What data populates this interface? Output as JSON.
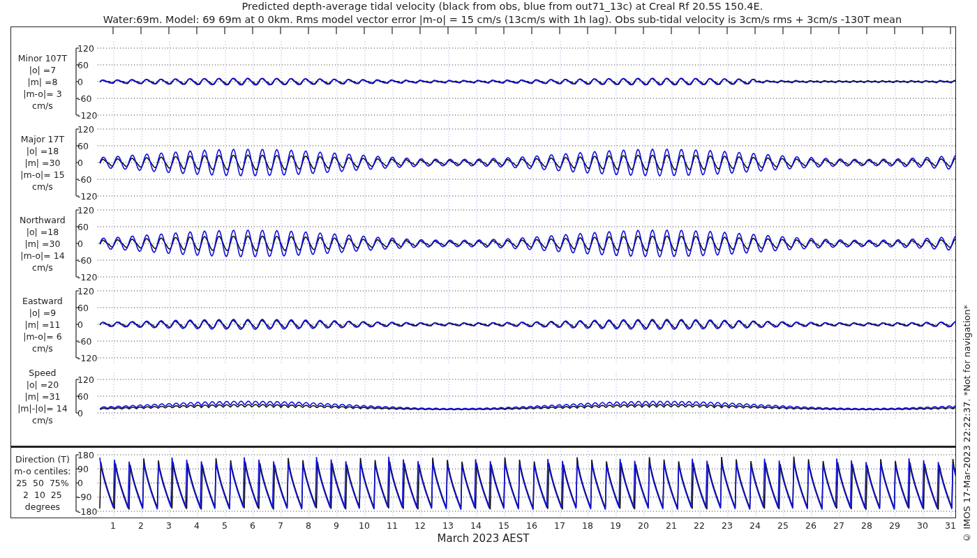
{
  "title_lines": [
    "Predicted depth-average tidal velocity (black from obs, blue from out71_13c) at Creal Rf 20.5S 150.4E.",
    "Water:69m. Model: 69 69m at 0 0km. Rms model vector error |m-o| = 15 cm/s (13cm/s with 1h lag). Obs sub-tidal velocity is 3cm/s rms + 3cm/s -130T mean"
  ],
  "panels": [
    {
      "kind": "velocity",
      "label_lines": [
        "Minor 107T",
        "|o| =7",
        "|m| =8",
        "|m-o|= 3",
        "cm/s"
      ],
      "yticks": [
        "120",
        "60",
        "0",
        "-60",
        "-120"
      ]
    },
    {
      "kind": "velocity",
      "label_lines": [
        "Major 17T",
        "|o| =18",
        "|m| =30",
        "|m-o|= 15",
        "cm/s"
      ],
      "yticks": [
        "120",
        "60",
        "0",
        "-60",
        "-120"
      ]
    },
    {
      "kind": "velocity",
      "label_lines": [
        "Northward",
        "|o| =18",
        "|m| =30",
        "|m-o|= 14",
        "cm/s"
      ],
      "yticks": [
        "120",
        "60",
        "0",
        "-60",
        "-120"
      ]
    },
    {
      "kind": "velocity",
      "label_lines": [
        "Eastward",
        "|o| =9",
        "|m| =11",
        "|m-o|= 6",
        "cm/s"
      ],
      "yticks": [
        "120",
        "60",
        "0",
        "-60",
        "-120"
      ]
    },
    {
      "kind": "speed",
      "label_lines": [
        "Speed",
        "|o| =20",
        "|m| =31",
        "|m|-|o|= 14",
        "cm/s"
      ],
      "yticks": [
        "120",
        "60",
        "0"
      ]
    }
  ],
  "direction_panel": {
    "kind": "direction",
    "label_lines": [
      "Direction (T)",
      "m-o centiles:",
      "25  50  75%",
      "2  10  25",
      "degrees"
    ],
    "yticks": [
      "180",
      "90",
      "0",
      "-90",
      "-180"
    ]
  },
  "x_ticks": [
    "1",
    "2",
    "3",
    "4",
    "5",
    "6",
    "7",
    "8",
    "9",
    "10",
    "11",
    "12",
    "13",
    "14",
    "15",
    "16",
    "17",
    "18",
    "19",
    "20",
    "21",
    "22",
    "23",
    "24",
    "25",
    "26",
    "27",
    "28",
    "29",
    "30",
    "31"
  ],
  "xlabel": "March 2023 AEST",
  "footer_note": "© IMOS 17-Mar-2023 22:22:37. *Not for navigation*"
}
